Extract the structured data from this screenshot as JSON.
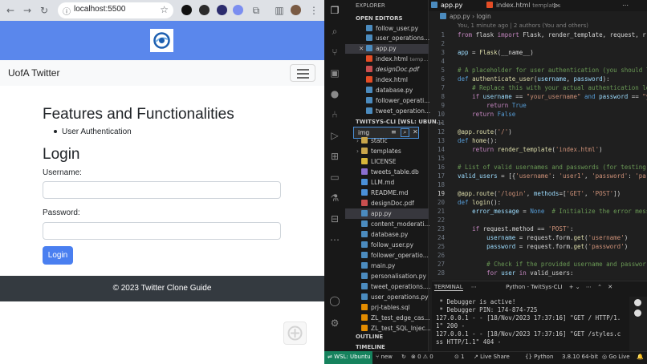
{
  "browser": {
    "url": "localhost:5500",
    "site": {
      "brand": "UofA Twitter",
      "features_title": "Features and Functionalities",
      "features": [
        "User Authentication"
      ],
      "login_title": "Login",
      "username_label": "Username:",
      "password_label": "Password:",
      "login_button": "Login",
      "footer": "© 2023 Twitter Clone Guide"
    }
  },
  "vscode": {
    "explorer_title": "EXPLORER",
    "open_editors_label": "OPEN EDITORS",
    "open_editors": [
      "follow_user.py",
      "user_operations...",
      "app.py",
      "index.html",
      "designDoc.pdf",
      "index.html",
      "database.py",
      "follower_operati...",
      "tweet_operation..."
    ],
    "open_editors_extra": "temp...",
    "workspace_label": "TWITSYS-CLI [WSL: UBUN...",
    "filter_value": "img",
    "files": [
      "static",
      "templates",
      "LICENSE",
      "tweets_table.db",
      "LLM.md",
      "README.md",
      "designDoc.pdf",
      "app.py",
      "content_moderati...",
      "database.py",
      "follow_user.py",
      "follower_operatio...",
      "main.py",
      "personalisation.py",
      "tweet_operations....",
      "user_operations.py",
      "prj-tables.sql",
      "ZL_test_edge_cas...",
      "ZL_test_SQL_Injec..."
    ],
    "outline_label": "OUTLINE",
    "timeline_label": "TIMELINE",
    "tabs": [
      "app.py",
      "index.html",
      "templates"
    ],
    "breadcrumb": [
      "app.py",
      "login"
    ],
    "blame": "You, 1 minute ago | 2 authors (You and others)",
    "line_numbers": [
      "1",
      "2",
      "3",
      "4",
      "5",
      "6",
      "7",
      "8",
      "9",
      "10",
      "11",
      "12",
      "13",
      "14",
      "15",
      "16",
      "17",
      "18",
      "19",
      "20",
      "21",
      "22",
      "23",
      "24",
      "25",
      "26",
      "27",
      "28"
    ],
    "terminal": {
      "tab_label": "TERMINAL",
      "shell_label": "Python - TwitSys-CLI",
      "lines": [
        " * Debugger is active!",
        " * Debugger PIN: 174-874-725",
        "127.0.0.1 - - [18/Nov/2023 17:37:16] \"GET / HTTP/1.",
        "1\" 200 -",
        "127.0.0.1 - - [18/Nov/2023 17:37:16] \"GET /styles.c",
        "ss HTTP/1.1\" 404 -"
      ]
    },
    "status": {
      "remote": "WSL: Ubuntu",
      "branch": "new",
      "errors": "0",
      "warnings": "0",
      "ports": "1",
      "live_share": "Live Share",
      "language": "Python",
      "python_version": "3.8.10 64-bit",
      "go_live": "Go Live"
    }
  }
}
